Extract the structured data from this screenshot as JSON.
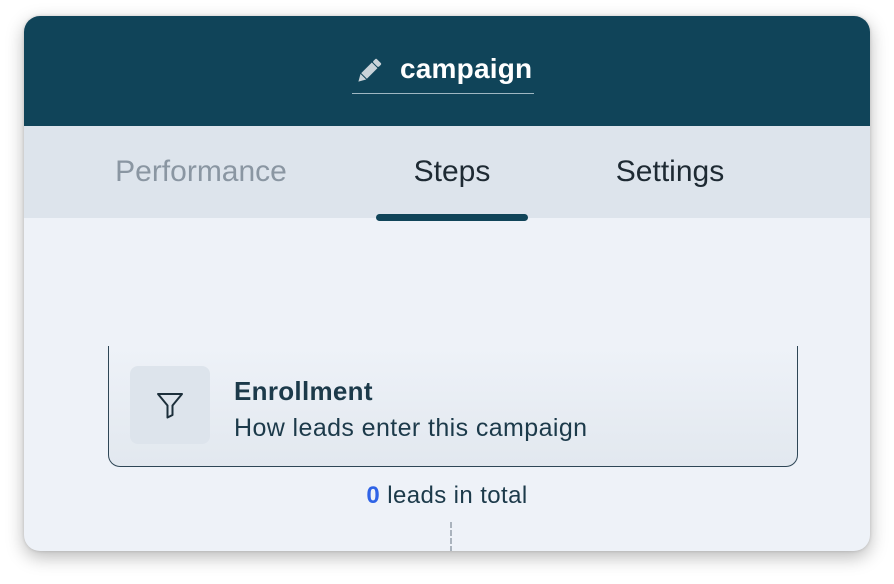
{
  "header": {
    "title": "campaign",
    "edit_icon": "pencil-icon",
    "background": "#104459"
  },
  "tabs": [
    {
      "label": "Performance",
      "active": false
    },
    {
      "label": "Steps",
      "active": true
    },
    {
      "label": "Settings",
      "active": false
    }
  ],
  "enrollment": {
    "icon": "funnel-icon",
    "title": "Enrollment",
    "subtitle": "How leads enter this campaign"
  },
  "leads": {
    "count": "0",
    "suffix": " leads in total",
    "count_color": "#2f63e6"
  }
}
